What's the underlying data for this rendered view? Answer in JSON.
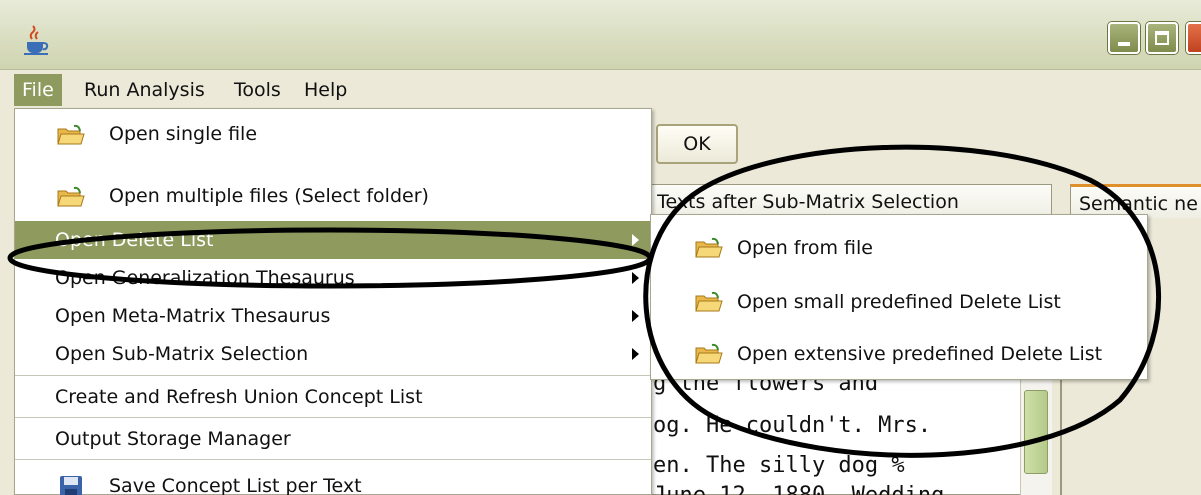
{
  "window": {
    "icon": "java-coffee-cup-icon",
    "controls": [
      "minimize-icon",
      "maximize-icon",
      "close-icon"
    ]
  },
  "menubar": {
    "items": [
      {
        "label": "File",
        "active": true
      },
      {
        "label": "Run Analysis"
      },
      {
        "label": "Tools"
      },
      {
        "label": "Help"
      }
    ]
  },
  "background": {
    "ok_label": "OK",
    "tabs": [
      {
        "label": ". Texts after Sub-Matrix Selection"
      },
      {
        "label": "Semantic ne"
      }
    ],
    "text_lines": [
      "g the flowers and",
      "og. He couldn't. Mrs.",
      "en. The silly dog %",
      "June 12, 1880. Wedding"
    ]
  },
  "file_menu": {
    "items": [
      {
        "label": "Open single file",
        "icon": "folder-open-icon"
      },
      {
        "label": "Open multiple files (Select folder)",
        "icon": "folder-open-icon"
      },
      {
        "label": "Open Delete List",
        "submenu": true,
        "highlighted": true
      },
      {
        "label": "Open Generalization Thesaurus",
        "submenu": true
      },
      {
        "label": "Open Meta-Matrix Thesaurus",
        "submenu": true
      },
      {
        "label": "Open Sub-Matrix Selection",
        "submenu": true
      },
      {
        "label": "Create and Refresh Union Concept List"
      },
      {
        "label": "Output Storage Manager"
      },
      {
        "label": "Save Concept List per Text",
        "icon": "floppy-disk-icon"
      }
    ]
  },
  "delete_list_submenu": {
    "items": [
      {
        "label": "Open from file",
        "icon": "folder-open-icon"
      },
      {
        "label": "Open small predefined Delete List",
        "icon": "folder-open-icon"
      },
      {
        "label": "Open extensive predefined Delete List",
        "icon": "folder-open-icon"
      }
    ]
  },
  "colors": {
    "highlight": "#8e9a5e",
    "titlebar": "#d9ddbf",
    "annotation_stroke": "#000000"
  }
}
